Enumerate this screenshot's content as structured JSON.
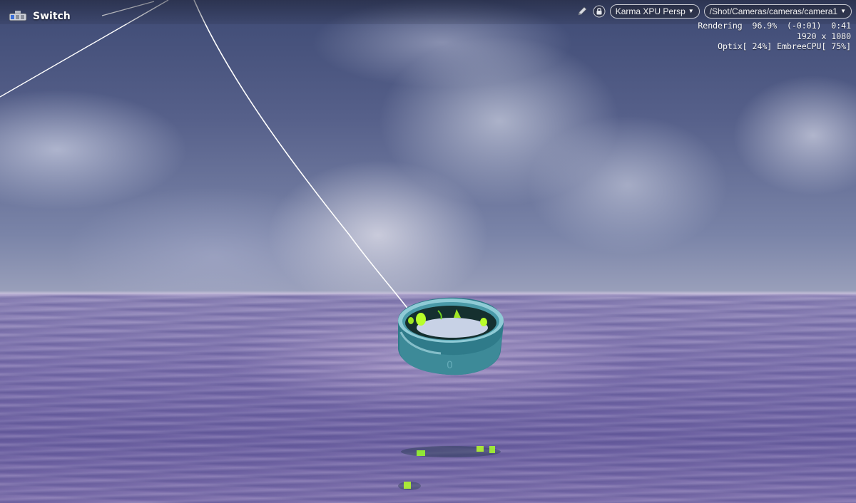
{
  "viewport": {
    "node_name": "Switch",
    "node_icon": "switch-node-icon"
  },
  "toolbar": {
    "edit_icon": "pencil-icon",
    "lock_icon": "lock-icon",
    "renderer_label": "Karma XPU  Persp",
    "camera_path": "/Shot/Cameras/cameras/camera1"
  },
  "stats": {
    "line1": "Rendering  96.9%  (-0:01)  0:41",
    "line2": "1920 x 1080",
    "line3": "Optix[ 24%] EmbreeCPU[ 75%]"
  },
  "colors": {
    "ring": "#3d8a98",
    "ring_highlight": "#9fd6df",
    "led_green": "#b8ff2a",
    "wire": "#ffffff"
  }
}
